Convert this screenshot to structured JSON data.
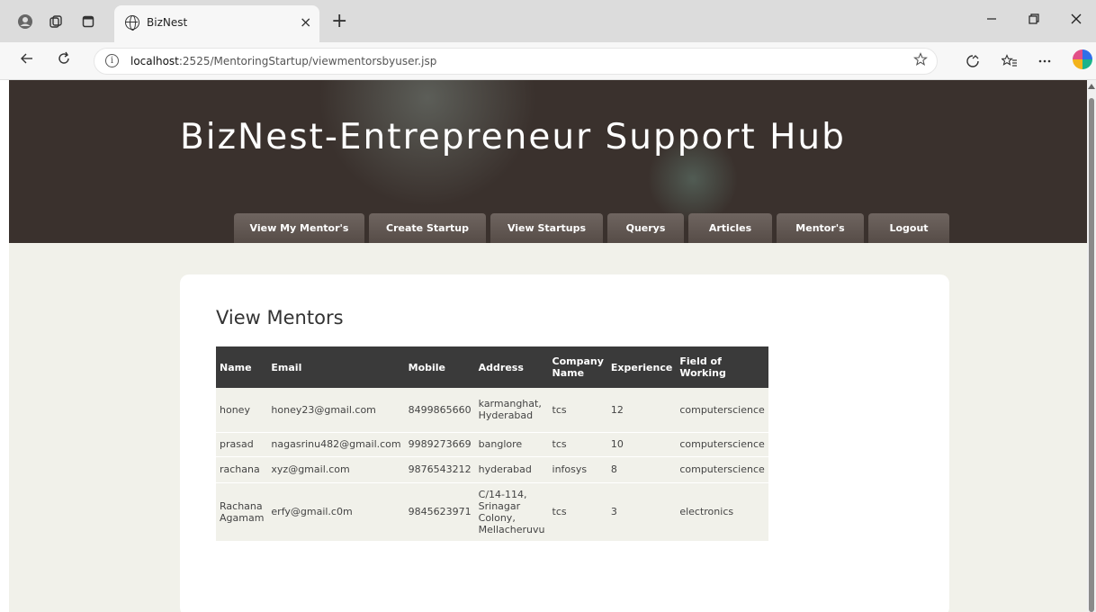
{
  "browser": {
    "tab_title": "BizNest",
    "tab_close": "×",
    "new_tab": "+",
    "url_host": "localhost",
    "url_rest": ":2525/MentoringStartup/viewmentorsbyuser.jsp"
  },
  "site": {
    "title": "BizNest-Entrepreneur Support Hub"
  },
  "nav": {
    "items": [
      "View My Mentor's",
      "Create Startup",
      "View Startups",
      "Querys",
      "Articles",
      "Mentor's",
      "Logout"
    ]
  },
  "main": {
    "title": "View Mentors",
    "table": {
      "headers": [
        "Name",
        "Email",
        "Mobile",
        "Address",
        "Company Name",
        "Experience",
        "Field of Working"
      ],
      "rows": [
        [
          "honey",
          "honey23@gmail.com",
          "8499865660",
          "karmanghat, Hyderabad",
          "tcs",
          "12",
          "computerscience"
        ],
        [
          "prasad",
          "nagasrinu482@gmail.com",
          "9989273669",
          "banglore",
          "tcs",
          "10",
          "computerscience"
        ],
        [
          "rachana",
          "xyz@gmail.com",
          "9876543212",
          "hyderabad",
          "infosys",
          "8",
          "computerscience"
        ],
        [
          "Rachana Agamam",
          "erfy@gmail.c0m",
          "9845623971",
          "C/14-114, Srinagar Colony, Mellacheruvu",
          "tcs",
          "3",
          "electronics"
        ]
      ]
    }
  }
}
